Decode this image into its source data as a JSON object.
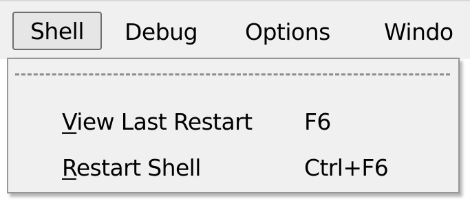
{
  "menubar": {
    "items": [
      {
        "label": "Shell",
        "active": true
      },
      {
        "label": "Debug"
      },
      {
        "label": "Options"
      },
      {
        "label": "Windo"
      }
    ]
  },
  "shell_menu": {
    "tearoff": "- - - - - - - - - - - - - - -",
    "entries": [
      {
        "mnemonic": "V",
        "label_rest": "iew Last Restart",
        "accelerator": "F6"
      },
      {
        "mnemonic": "R",
        "label_rest": "estart Shell",
        "accelerator": "Ctrl+F6"
      }
    ]
  },
  "colors": {
    "menu_background": "#f0f0f0",
    "menu_border": "#979797",
    "active_menu_border": "#6e6e6e",
    "text": "#000000"
  }
}
